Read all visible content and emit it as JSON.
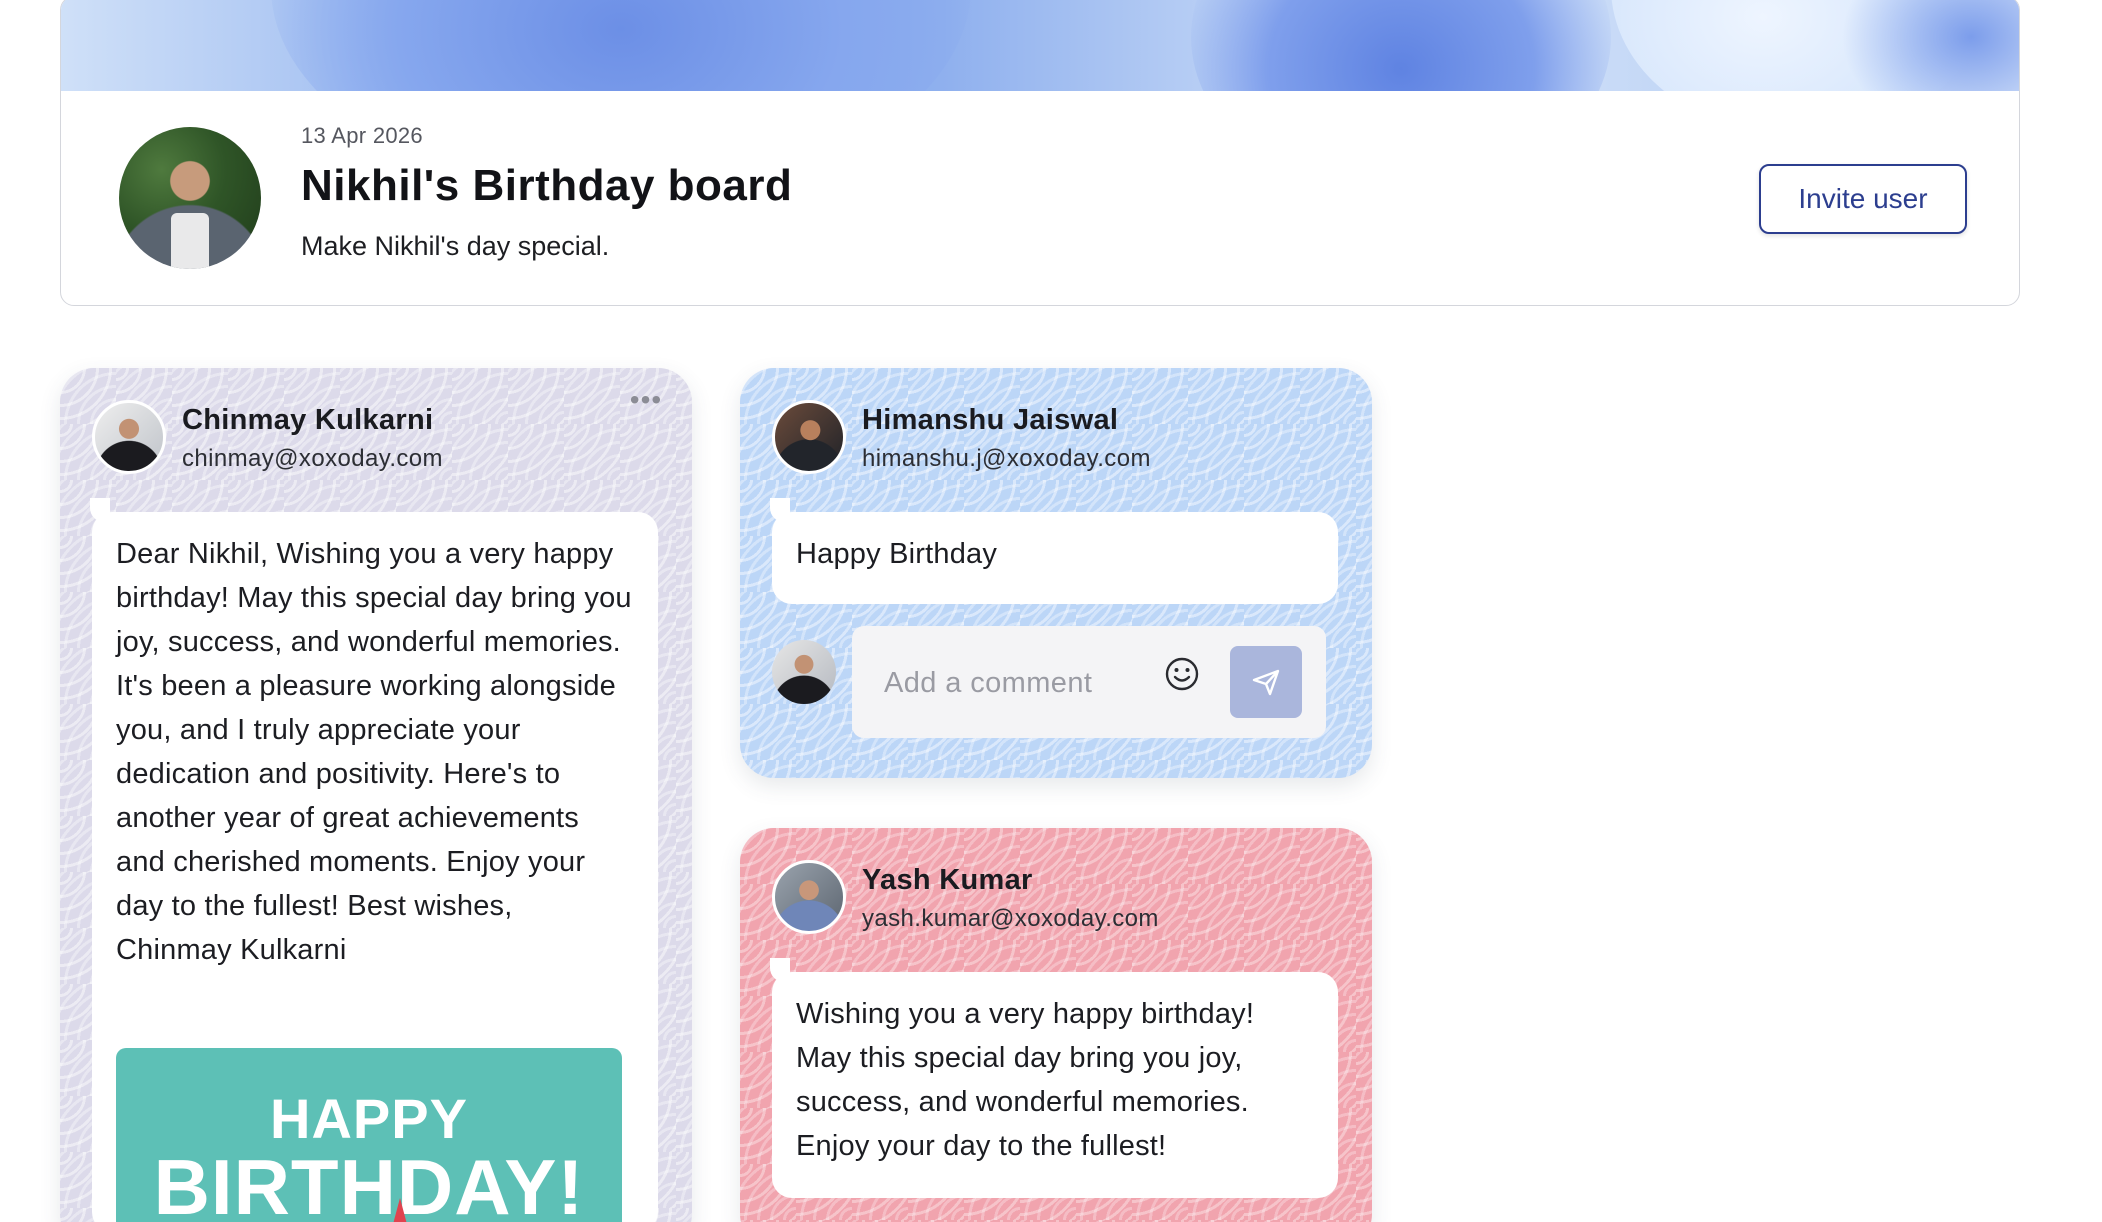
{
  "board": {
    "date": "13 Apr 2026",
    "title": "Nikhil's Birthday board",
    "subtitle": "Make Nikhil's day special.",
    "invite_label": "Invite user"
  },
  "posts": [
    {
      "author": "Chinmay Kulkarni",
      "email": "chinmay@xoxoday.com",
      "message": "Dear Nikhil, Wishing you a very happy birthday! May this special day bring you joy, success, and wonderful memories. It's been a pleasure working alongside you, and I truly appreciate your dedication and positivity. Here's to another year of great achievements and cherished moments. Enjoy your day to the fullest! Best wishes, Chinmay Kulkarni",
      "menu_icon": "more-horizontal-icon",
      "gif": {
        "line1": "HAPPY",
        "line2": "BIRTHDAY!"
      },
      "color": "#dcdaea"
    },
    {
      "author": "Himanshu Jaiswal",
      "email": "himanshu.j@xoxoday.com",
      "message": "Happy Birthday",
      "comment_placeholder": "Add a comment",
      "color": "#bcd6f7"
    },
    {
      "author": "Yash Kumar",
      "email": "yash.kumar@xoxoday.com",
      "message": "Wishing you a very happy birthday! May this special day bring you joy, success, and wonderful memories. Enjoy your day to the fullest!",
      "color": "#f1a4ae"
    }
  ],
  "icons": {
    "emoji": "smile-icon",
    "send": "send-icon",
    "menu": "more-horizontal-icon"
  },
  "colors": {
    "accent": "#2c3e8f",
    "send_button": "#aab6dc"
  }
}
